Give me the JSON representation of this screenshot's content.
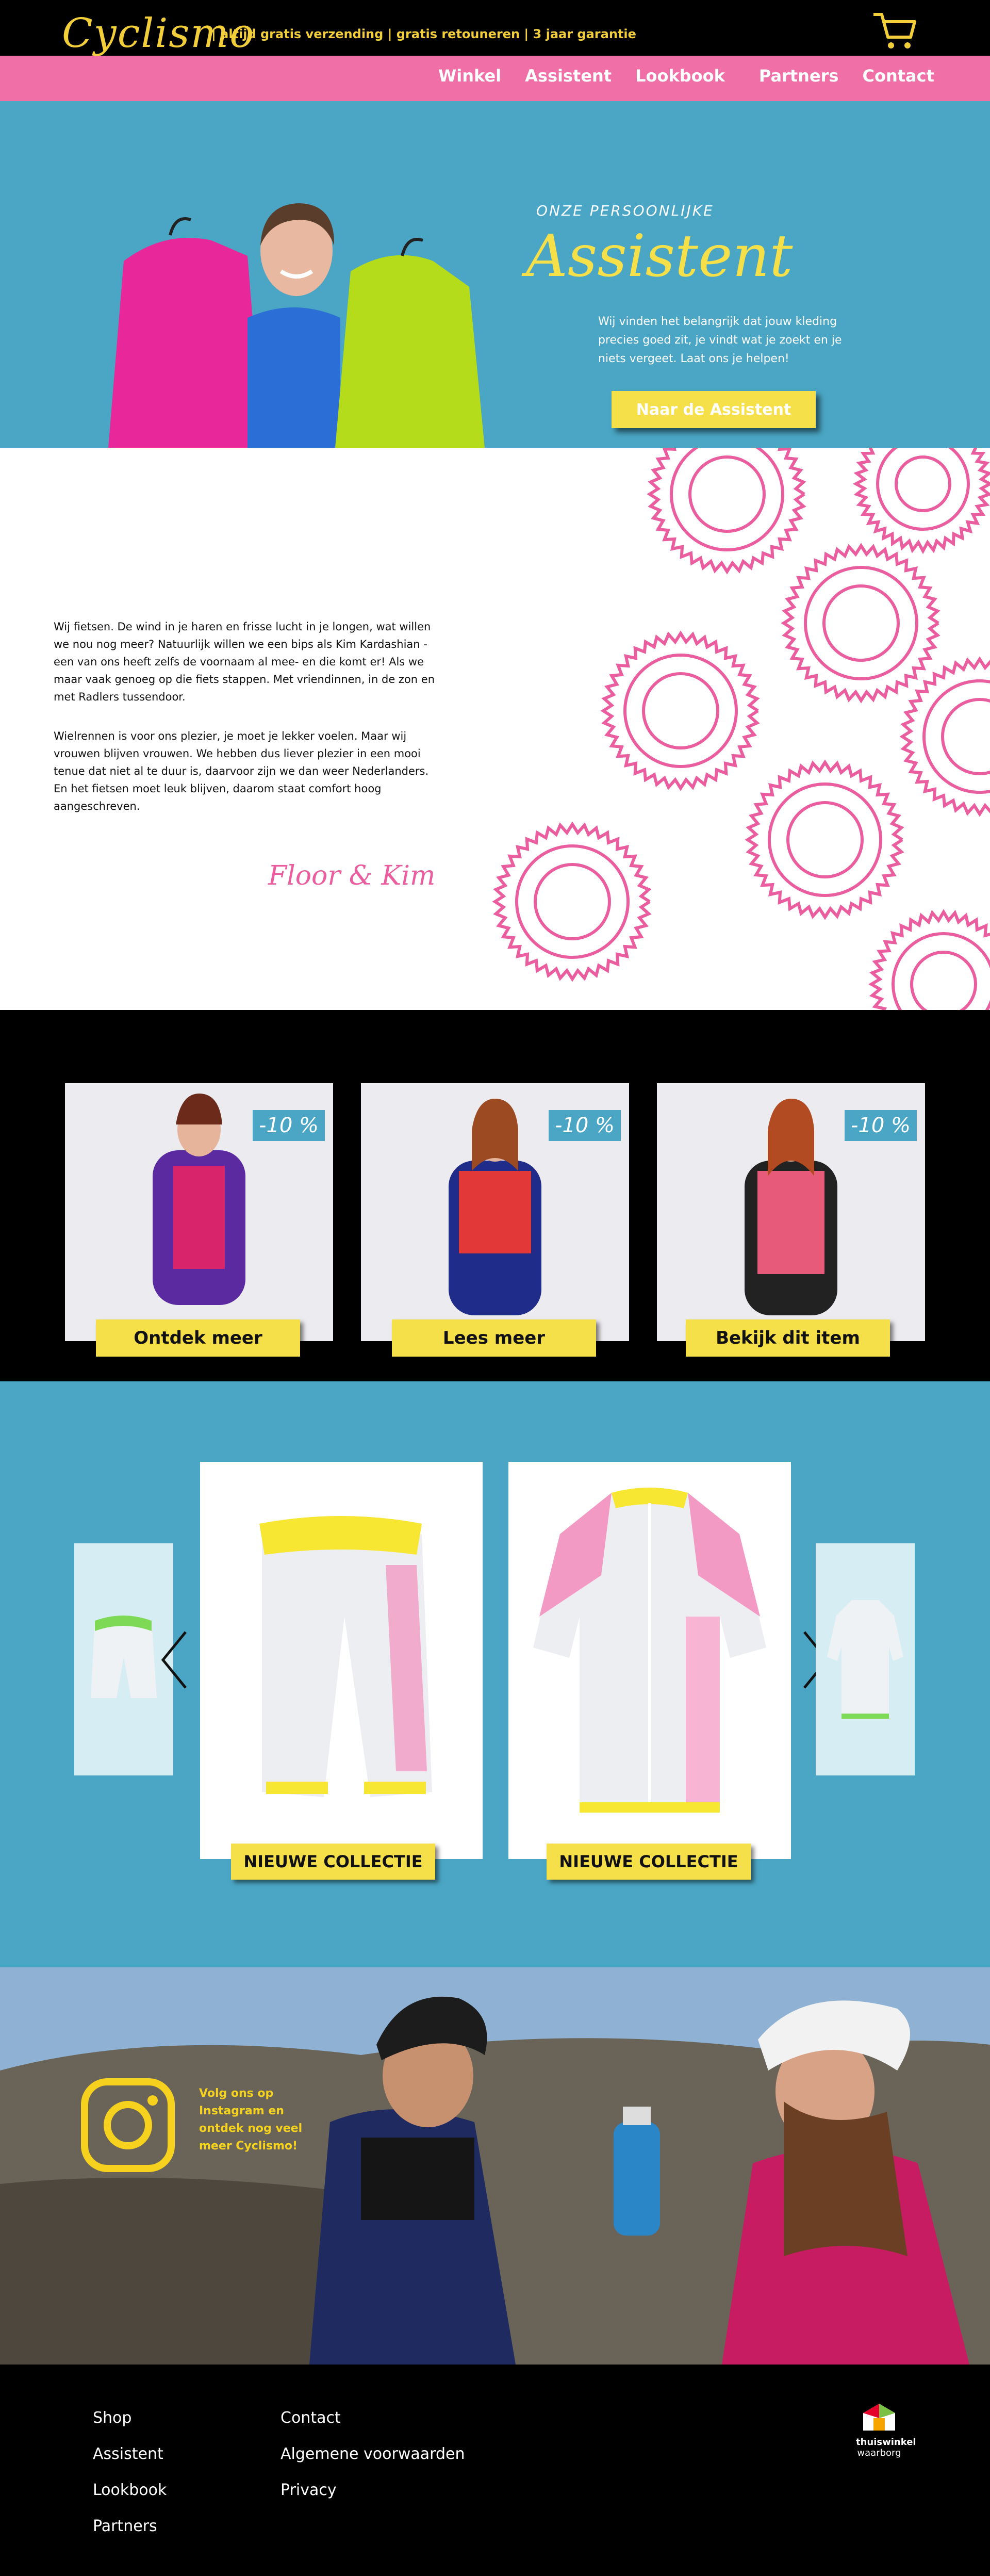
{
  "header": {
    "logo_text": "Cyclismo",
    "usp_text": "| altijd gratis verzending | gratis retouneren | 3 jaar garantie",
    "nav": [
      "Winkel",
      "Assistent",
      "Lookbook",
      "Partners",
      "Contact"
    ],
    "cart_icon": "shopping-cart-icon"
  },
  "hero": {
    "eyebrow": "ONZE PERSOONLIJKE",
    "title": "Assistent",
    "text": "Wij vinden het belangrijk dat jouw kleding precies goed zit, je vindt wat je zoekt en je niets vergeet. Laat ons je helpen!",
    "cta": "Naar de Assistent"
  },
  "about": {
    "paragraph1": "Wij fietsen. De wind in je haren en frisse lucht in je longen, wat willen we nou nog meer? Natuurlijk willen we een bips als Kim Kardashian - een van ons heeft zelfs de voornaam al mee- en die komt er! Als we maar vaak genoeg op die fiets stappen. Met vriendinnen, in de zon en met Radlers tussendoor.",
    "paragraph2": "Wielrennen is voor ons plezier, je moet je lekker voelen. Maar wij vrouwen blijven vrouwen. We hebben dus liever plezier in een mooi tenue dat niet al te duur is, daarvoor zijn we dan weer Nederlanders. En het fietsen moet leuk blijven, daarom staat comfort hoog aangeschreven.",
    "signature": "Floor & Kim"
  },
  "products": [
    {
      "discount": "-10 %",
      "button": "Ontdek meer"
    },
    {
      "discount": "-10 %",
      "button": "Lees meer"
    },
    {
      "discount": "-10 %",
      "button": "Bekijk dit item"
    }
  ],
  "collection": {
    "cards": [
      {
        "item": "cycling-shorts",
        "button": "NIEUWE COLLECTIE"
      },
      {
        "item": "cycling-jersey",
        "button": "NIEUWE COLLECTIE"
      }
    ],
    "prev_icon": "chevron-left-icon",
    "next_icon": "chevron-right-icon"
  },
  "instagram": {
    "text": "Volg ons op Instagram en ontdek nog veel meer Cyclismo!",
    "icon": "instagram-icon"
  },
  "footer": {
    "col1": [
      "Shop",
      "Assistent",
      "Lookbook",
      "Partners"
    ],
    "col2": [
      "Contact",
      "Algemene voorwaarden",
      "Privacy"
    ],
    "trust_line1": "thuiswinkel",
    "trust_line2": "waarborg"
  },
  "colors": {
    "accent_blue": "#4aa6c4",
    "accent_pink": "#f06fa6",
    "accent_yellow": "#f6e04a",
    "black": "#000000"
  }
}
